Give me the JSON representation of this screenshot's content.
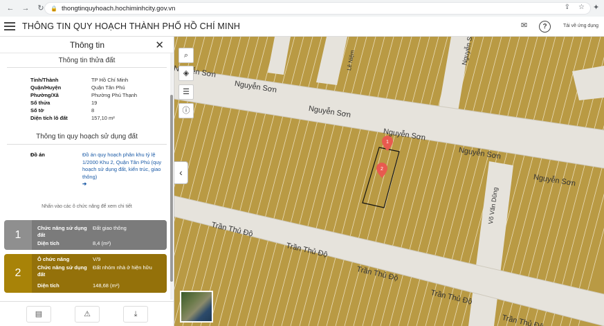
{
  "browser": {
    "url": "thongtinquyhoach.hochiminhcity.gov.vn",
    "back_icon": "arrow-left-icon",
    "forward_icon": "arrow-right-icon",
    "reload_icon": "reload-icon"
  },
  "header": {
    "title": "THÔNG TIN QUY HOẠCH THÀNH PHỐ HỒ CHÍ MINH",
    "help": "?",
    "app_link": "Tải về ứng dụng"
  },
  "panel": {
    "title": "Thông tin",
    "land_section_title": "Thông tin thửa đất",
    "land_info": [
      {
        "label": "Tỉnh/Thành",
        "value": "TP Hồ Chí Minh"
      },
      {
        "label": "Quận/Huyện",
        "value": "Quận Tân Phú"
      },
      {
        "label": "Phường/Xã",
        "value": "Phường Phú Thạnh"
      },
      {
        "label": "Số thửa",
        "value": "19"
      },
      {
        "label": "Số tờ",
        "value": "8"
      },
      {
        "label": "Diện tích lô đất",
        "value": "157,10 m²"
      }
    ],
    "plan_section_title": "Thông tin quy hoạch sử dụng đất",
    "project_label": "Đồ án",
    "project_link": "Đồ án quy hoạch phân khu tỷ lệ 1/2000 Khu 2, Quận Tân Phú (quy hoạch sử dụng đất, kiến trúc, giao thông)",
    "project_arrow": "➔",
    "hint": "Nhấn vào các ô chức năng để xem chi tiết",
    "cards": [
      {
        "number": "1",
        "rows": [
          {
            "label": "Chức năng sử dụng đất",
            "value": "Đất giao thông"
          },
          {
            "label": "Diện tích",
            "value": "8,4 (m²)"
          }
        ]
      },
      {
        "number": "2",
        "rows": [
          {
            "label": "Ô chức năng",
            "value": "V/9"
          },
          {
            "label": "Chức năng sử dụng đất",
            "value": "Đất nhóm nhà ở hiện hữu"
          },
          {
            "label": "Diện tích",
            "value": "148,68 (m²)"
          }
        ]
      }
    ]
  },
  "map": {
    "streets": [
      {
        "name": "Nguyễn Sơn"
      },
      {
        "name": "Nguyễn Sơn"
      },
      {
        "name": "Nguyễn Sơn"
      },
      {
        "name": "Nguyễn Sơn"
      },
      {
        "name": "Nguyễn Sơn"
      },
      {
        "name": "Nguyễn Sơn"
      },
      {
        "name": "Trần Thủ Độ"
      },
      {
        "name": "Trần Thủ Độ"
      },
      {
        "name": "Trần Thủ Độ"
      },
      {
        "name": "Trần Thủ Độ"
      },
      {
        "name": "Trần Thủ Độ"
      },
      {
        "name": "Võ Văn Dũng"
      },
      {
        "name": "Nguyễn Sơn"
      },
      {
        "name": "Lê Niệm"
      }
    ],
    "markers": [
      "1",
      "2"
    ],
    "colors": {
      "land": "#b99a44",
      "road": "#e6e3dc",
      "parcel_line": "#ffffff",
      "marker": "#e85a4f"
    }
  }
}
